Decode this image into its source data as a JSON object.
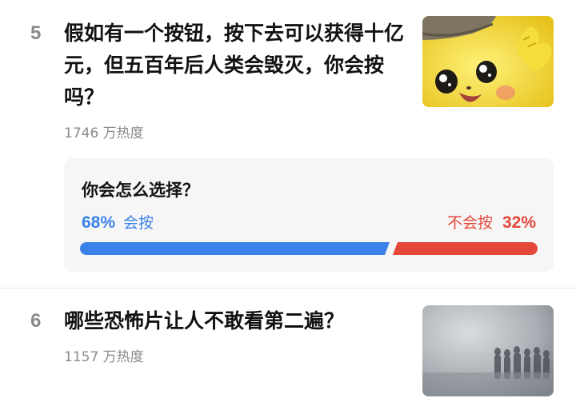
{
  "items": [
    {
      "rank": "5",
      "title": "假如有一个按钮，按下去可以获得十亿元，但五百年后人类会毁灭，你会按吗？",
      "heat": "1746 万热度",
      "thumbnail_icon": "cartoon-character-image",
      "poll": {
        "question": "你会怎么选择？",
        "left_option": {
          "label": "会按",
          "percent": "68%",
          "value": 68,
          "color": "#3b82e8"
        },
        "right_option": {
          "label": "不会按",
          "percent": "32%",
          "value": 32,
          "color": "#e5473b"
        }
      }
    },
    {
      "rank": "6",
      "title": "哪些恐怖片让人不敢看第二遍？",
      "heat": "1157 万热度",
      "thumbnail_icon": "foggy-silhouettes-image"
    }
  ]
}
